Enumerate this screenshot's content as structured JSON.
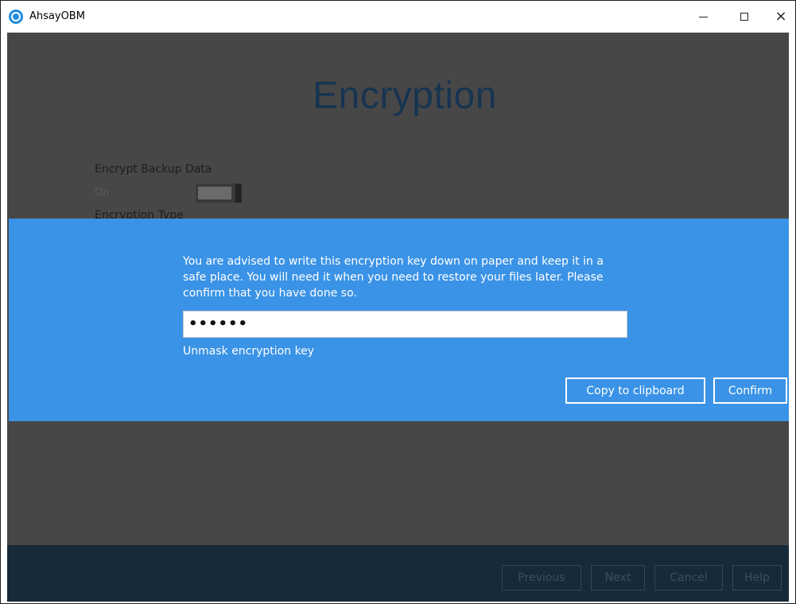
{
  "window": {
    "app_name": "AhsayOBM",
    "minimize_glyph": "minimize",
    "maximize_glyph": "maximize",
    "close_glyph": "×"
  },
  "page": {
    "title": "Encryption",
    "encrypt_label": "Encrypt Backup Data",
    "toggle_state": "On",
    "encryption_type_label": "Encryption Type"
  },
  "dialog": {
    "message": "You are advised to write this encryption key down on paper and keep it in a safe place. You will need it when you need to restore your files later. Please confirm that you have done so.",
    "key_value": "••••••",
    "unmask_label": "Unmask encryption key",
    "copy_label": "Copy to clipboard",
    "confirm_label": "Confirm"
  },
  "footer": {
    "previous_label": "Previous",
    "next_label": "Next",
    "cancel_label": "Cancel",
    "help_label": "Help"
  },
  "colors": {
    "dialog_bg": "#3a93e6",
    "overlay_bg": "#474747",
    "footer_bg": "#172a3a",
    "title_color": "#173451"
  },
  "icons": {
    "app": "ahsay-logo-icon",
    "minimize": "minimize-icon",
    "maximize": "maximize-icon",
    "close": "close-icon"
  }
}
